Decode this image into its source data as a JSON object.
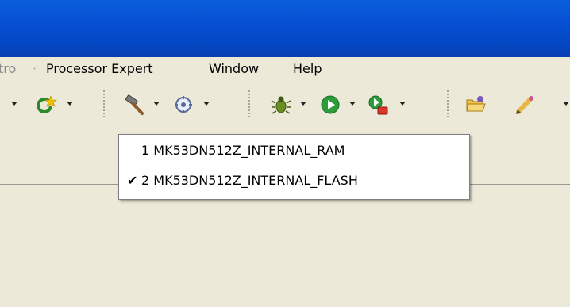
{
  "menubar": {
    "partial_item": "tro",
    "items": [
      {
        "label": "Processor Expert"
      },
      {
        "label": "Window"
      },
      {
        "label": "Help"
      }
    ]
  },
  "toolbar": {
    "icons": [
      "new-wizard-icon",
      "hammer-build-icon",
      "build-configuration-icon",
      "debug-bug-icon",
      "run-icon",
      "external-tool-run-icon",
      "open-folder-icon",
      "edit-pencil-icon"
    ]
  },
  "build_configurations_menu": {
    "items": [
      {
        "label": "1 MK53DN512Z_INTERNAL_RAM",
        "checked": false
      },
      {
        "label": "2 MK53DN512Z_INTERNAL_FLASH",
        "checked": true
      }
    ],
    "check_glyph": "✔"
  },
  "colors": {
    "titlebar": "#0650d6",
    "chrome": "#ece9d8",
    "menu_background": "#ffffff"
  }
}
